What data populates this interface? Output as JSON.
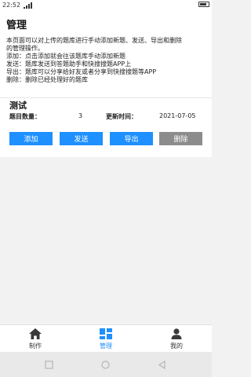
{
  "status_bar": {
    "time": "22:52",
    "signal_text": "4G"
  },
  "page": {
    "title": "管理",
    "intro_lines": [
      "本页面可以对上传的题库进行手动添加新题、发送、导出和删除",
      "的管理操作。",
      "添加：点击添加就会往该题库手动添加新题",
      "发送：题库发送到答题助手和快搜搜题APP上",
      "导出：题库可以分享给好友或者分享到快搜搜题等APP",
      "删除：删除已经处理好的题库"
    ]
  },
  "bank": {
    "name": "测试",
    "count_label": "题目数量：",
    "count_value": "3",
    "date_label": "更新时间：",
    "date_value": "2021-07-05"
  },
  "actions": {
    "add": "添加",
    "send": "发送",
    "export": "导出",
    "delete": "删除",
    "accent_color": "#1e90ff",
    "delete_color": "#8c8c8c"
  },
  "bottom_nav": {
    "items": [
      {
        "label": "制作",
        "icon": "home-icon"
      },
      {
        "label": "管理",
        "icon": "dashboard-icon",
        "active": true
      },
      {
        "label": "我的",
        "icon": "user-icon"
      }
    ]
  }
}
